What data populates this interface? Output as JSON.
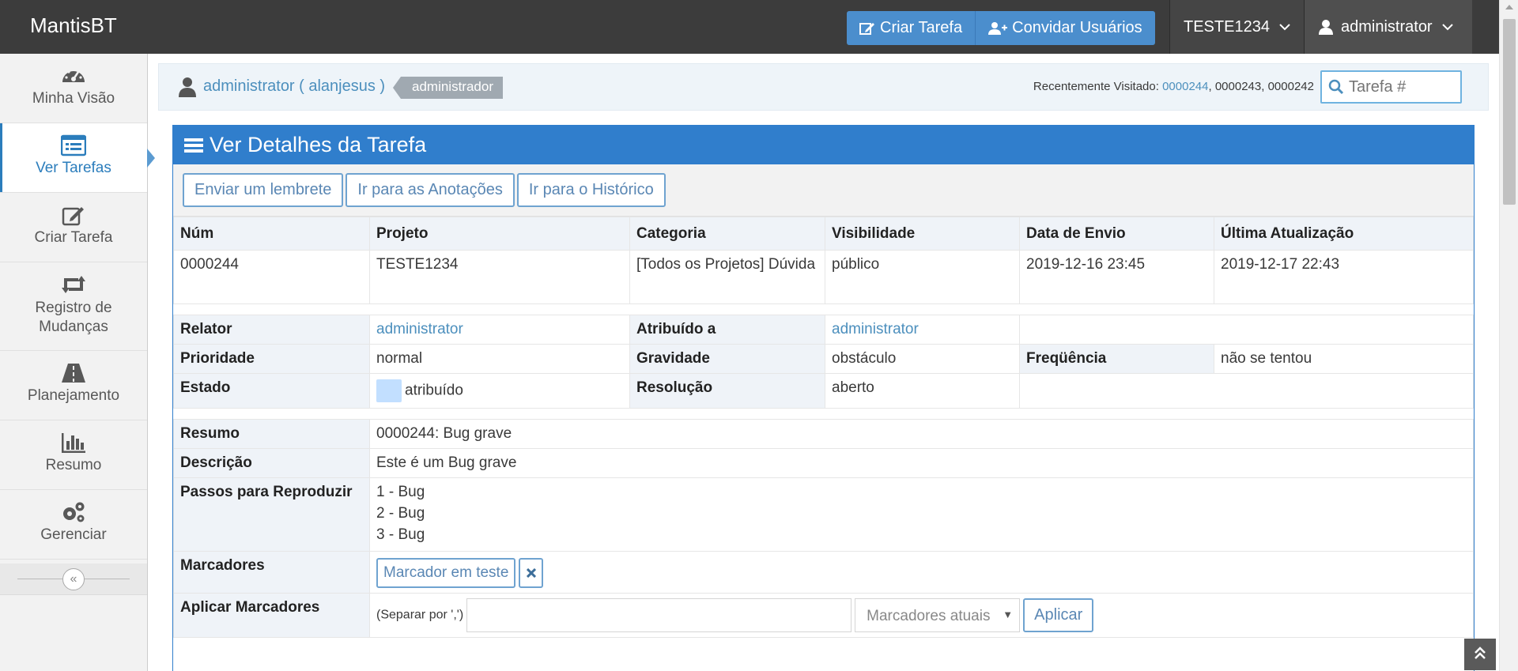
{
  "app": {
    "brand": "MantisBT"
  },
  "navbar": {
    "create_task": "Criar Tarefa",
    "invite_users": "Convidar Usuários",
    "project": "TESTE1234",
    "user": "administrator"
  },
  "sidebar": {
    "items": [
      {
        "label": "Minha Visão",
        "icon": "dashboard-icon"
      },
      {
        "label": "Ver Tarefas",
        "icon": "list-icon"
      },
      {
        "label": "Criar Tarefa",
        "icon": "edit-icon"
      },
      {
        "label": "Registro de Mudanças",
        "icon": "retweet-icon"
      },
      {
        "label": "Planejamento",
        "icon": "road-icon"
      },
      {
        "label": "Resumo",
        "icon": "bar-chart-icon"
      },
      {
        "label": "Gerenciar",
        "icon": "gears-icon"
      }
    ],
    "collapse_glyph": "«"
  },
  "breadcrumbs": {
    "user": "administrator ( alanjesus )",
    "role": "administrador",
    "recent_label": "Recentemente Visitado:",
    "recent_links": [
      "0000244",
      "0000243",
      "0000242"
    ],
    "search_placeholder": "Tarefa #"
  },
  "widget": {
    "title": "Ver Detalhes da Tarefa",
    "buttons": [
      "Enviar um lembrete",
      "Ir para as Anotações",
      "Ir para o Histórico"
    ]
  },
  "details": {
    "headers": [
      "Núm",
      "Projeto",
      "Categoria",
      "Visibilidade",
      "Data de Envio",
      "Última Atualização"
    ],
    "values": [
      "0000244",
      "TESTE1234",
      "[Todos os Projetos] Dúvida",
      "público",
      "2019-12-16 23:45",
      "2019-12-17 22:43"
    ],
    "relator_label": "Relator",
    "relator": "administrator",
    "assigned_label": "Atribuído a",
    "assigned": "administrator",
    "priority_label": "Prioridade",
    "priority": "normal",
    "severity_label": "Gravidade",
    "severity": "obstáculo",
    "frequency_label": "Freqüência",
    "frequency": "não se tentou",
    "status_label": "Estado",
    "status": "atribuído",
    "status_color": "#c2dfff",
    "resolution_label": "Resolução",
    "resolution": "aberto",
    "summary_label": "Resumo",
    "summary": "0000244: Bug grave",
    "description_label": "Descrição",
    "description": "Este é um Bug grave",
    "steps_label": "Passos para Reproduzir",
    "steps": [
      "1 - Bug",
      "2 - Bug",
      "3 - Bug"
    ],
    "tags_label": "Marcadores",
    "tag": "Marcador em teste",
    "apply_tags_label": "Aplicar Marcadores",
    "apply_hint": "(Separar por ',')",
    "apply_select": "Marcadores atuais",
    "apply_button": "Aplicar"
  },
  "colors": {
    "navbar": "#3c3c3c",
    "accent": "#307ecc",
    "link": "#4c8fbd"
  }
}
